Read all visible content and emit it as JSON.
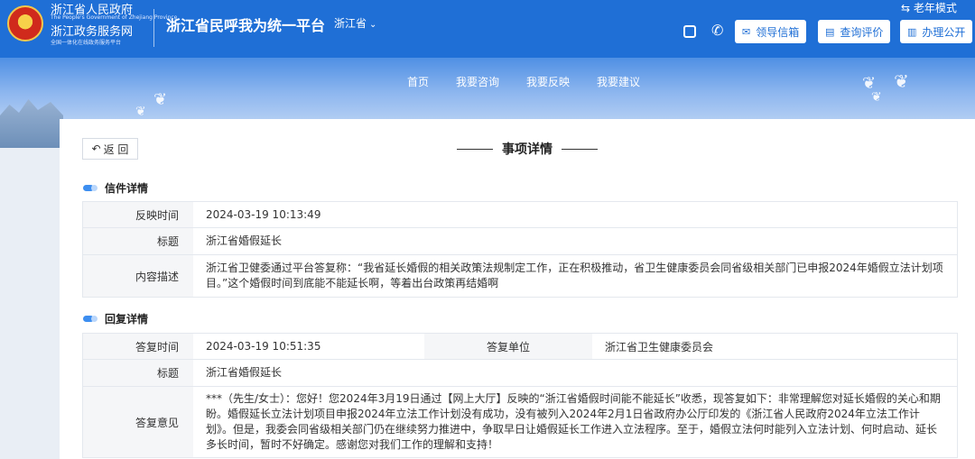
{
  "header": {
    "gov_name": "浙江省人民政府",
    "gov_name_en": "The People's Government of Zhejiang Province",
    "portal_name": "浙江政务服务网",
    "portal_slogan": "全国一体化在线政务服务平台",
    "platform_title": "浙江省民呼我为统一平台",
    "province_selector": "浙江省",
    "elder_mode": "老年模式",
    "buttons": {
      "leader_mail": "领导信箱",
      "query_review": "查询评价",
      "handle_public": "办理公开"
    }
  },
  "nav": {
    "items": [
      "首页",
      "我要咨询",
      "我要反映",
      "我要建议"
    ]
  },
  "page": {
    "back_label": "返 回",
    "title": "事项详情"
  },
  "letter": {
    "section_title": "信件详情",
    "time_label": "反映时间",
    "time_value": "2024-03-19 10:13:49",
    "subject_label": "标题",
    "subject_value": "浙江省婚假延长",
    "content_label": "内容描述",
    "content_value": "浙江省卫健委通过平台答复称：“我省延长婚假的相关政策法规制定工作，正在积极推动，省卫生健康委员会同省级相关部门已申报2024年婚假立法计划项目。”这个婚假时间到底能不能延长啊，等着出台政策再结婚啊"
  },
  "reply": {
    "section_title": "回复详情",
    "time_label": "答复时间",
    "time_value": "2024-03-19 10:51:35",
    "unit_label": "答复单位",
    "unit_value": "浙江省卫生健康委员会",
    "subject_label": "标题",
    "subject_value": "浙江省婚假延长",
    "opinion_label": "答复意见",
    "opinion_value": "***（先生/女士）：您好！您2024年3月19日通过【网上大厅】反映的“浙江省婚假时间能不能延长”收悉，现答复如下：非常理解您对延长婚假的关心和期盼。婚假延长立法计划项目申报2024年立法工作计划没有成功，没有被列入2024年2月1日省政府办公厅印发的《浙江省人民政府2024年立法工作计划》。但是，我委会同省级相关部门仍在继续努力推进中，争取早日让婚假延长工作进入立法程序。至于，婚假立法何时能列入立法计划、何时启动、延长多长时间，暂时不好确定。感谢您对我们工作的理解和支持！"
  }
}
